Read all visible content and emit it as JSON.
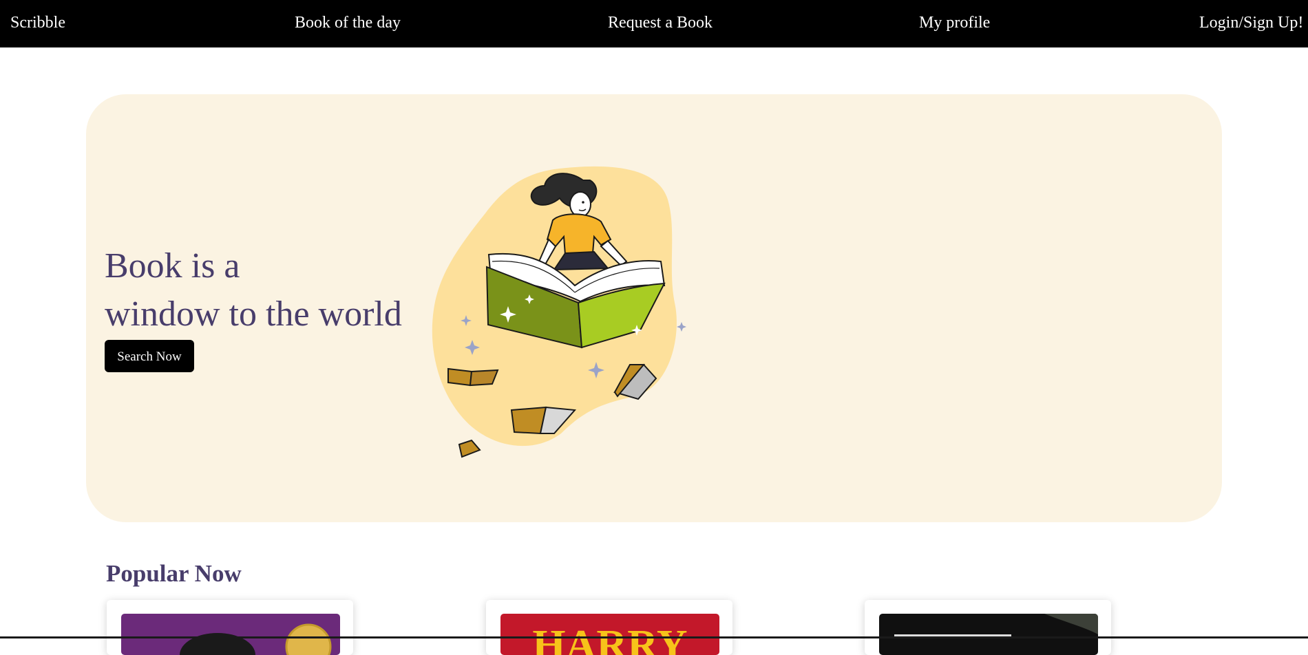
{
  "nav": {
    "brand": "Scribble",
    "book_of_day": "Book of the day",
    "request_book": "Request a Book",
    "my_profile": "My profile",
    "login": "Login/Sign Up!"
  },
  "hero": {
    "title_line1": "Book is a",
    "title_line2": "window to the world",
    "search_button": "Search Now",
    "illustration": "woman-reading-flying-book-illustration"
  },
  "popular": {
    "title": "Popular Now",
    "cards": [
      {
        "cover_icon": "purple-book-cover-with-gold-seal"
      },
      {
        "cover_icon": "harry-book-cover",
        "cover_text": "HARRY"
      },
      {
        "cover_icon": "dark-book-cover"
      }
    ]
  },
  "colors": {
    "nav_bg": "#000000",
    "hero_bg": "#fbf3e2",
    "title_text": "#483d6b",
    "button_bg": "#000000",
    "blob": "#fde09b",
    "book_green_dark": "#7a9219",
    "book_green_light": "#a8cc23"
  }
}
